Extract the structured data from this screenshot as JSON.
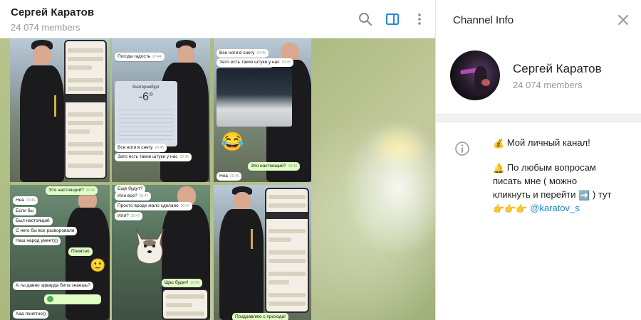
{
  "chat": {
    "title": "Сергей Каратов",
    "members": "24 074 members",
    "icons": {
      "search": "search-icon",
      "sidebar": "sidebar-toggle-icon",
      "more": "more-vertical-icon"
    }
  },
  "album": {
    "tile1": {
      "icon": "photo"
    },
    "tile2": {
      "bubble_top": "Погода гадость",
      "bubble_top_time": "20:44",
      "city": "Екатеринбург",
      "temp": "-6°",
      "bubble_mid": "Все ноги в снегу",
      "bubble_mid_time": "20:45",
      "bubble_bot": "Зато есть такие штуки у нас",
      "bubble_bot_time": "20:45"
    },
    "tile3": {
      "bubble1": "Все ноги в снегу",
      "bubble1_time": "20:45",
      "bubble2": "Зато есть такие штуки у нас",
      "bubble2_time": "20:45",
      "emoji": "😂",
      "bubble3": "Это настоящий?",
      "bubble3_time": "20:46",
      "bubble4": "Неа",
      "bubble4_time": "20:46"
    },
    "tile4": {
      "bubble0": "Это настоящий?",
      "bubble0_time": "20:46",
      "bubble1": "Неа",
      "bubble1_time": "20:46",
      "bubble2": "Если бы",
      "bubble3": "Был настоящий",
      "bubble4": "С него бы все разворовали",
      "bubble5": "Наш народ умеет)))",
      "bubble6": "Понятно",
      "emoji": "🙂",
      "bubble7": "А ты давно эдварда била знаешь?",
      "bubble8": "Ааа понятно))"
    },
    "tile5": {
      "bubble1": "Ещё будут?",
      "bubble2": "Или все?",
      "bubble2_time": "20:47",
      "bubble3": "Просто вроде мало сделано",
      "bubble3_time": "20:47",
      "bubble4": "Или?",
      "bubble4_time": "20:47",
      "bubble5": "Щас будет!",
      "bubble5_time": "20:48"
    },
    "tile6": {
      "bubble1": "Поздравляю с прохода!"
    }
  },
  "panel": {
    "title": "Channel Info",
    "name": "Сергей Каратов",
    "members": "24 074 members",
    "desc_line1": "Мой личный канал!",
    "desc_line2a": "По любым вопросам",
    "desc_line2b": "писать мне ( можно",
    "desc_line2c_pre": "кликнуть и перейти",
    "desc_line2c_post": ") тут",
    "handle": "@karatov_s",
    "emoji_bag": "💰",
    "emoji_bell": "🔔",
    "emoji_arrow": "➡️",
    "emoji_point": "👉👉👉",
    "icons": {
      "close": "close-icon",
      "info": "info-icon"
    }
  }
}
